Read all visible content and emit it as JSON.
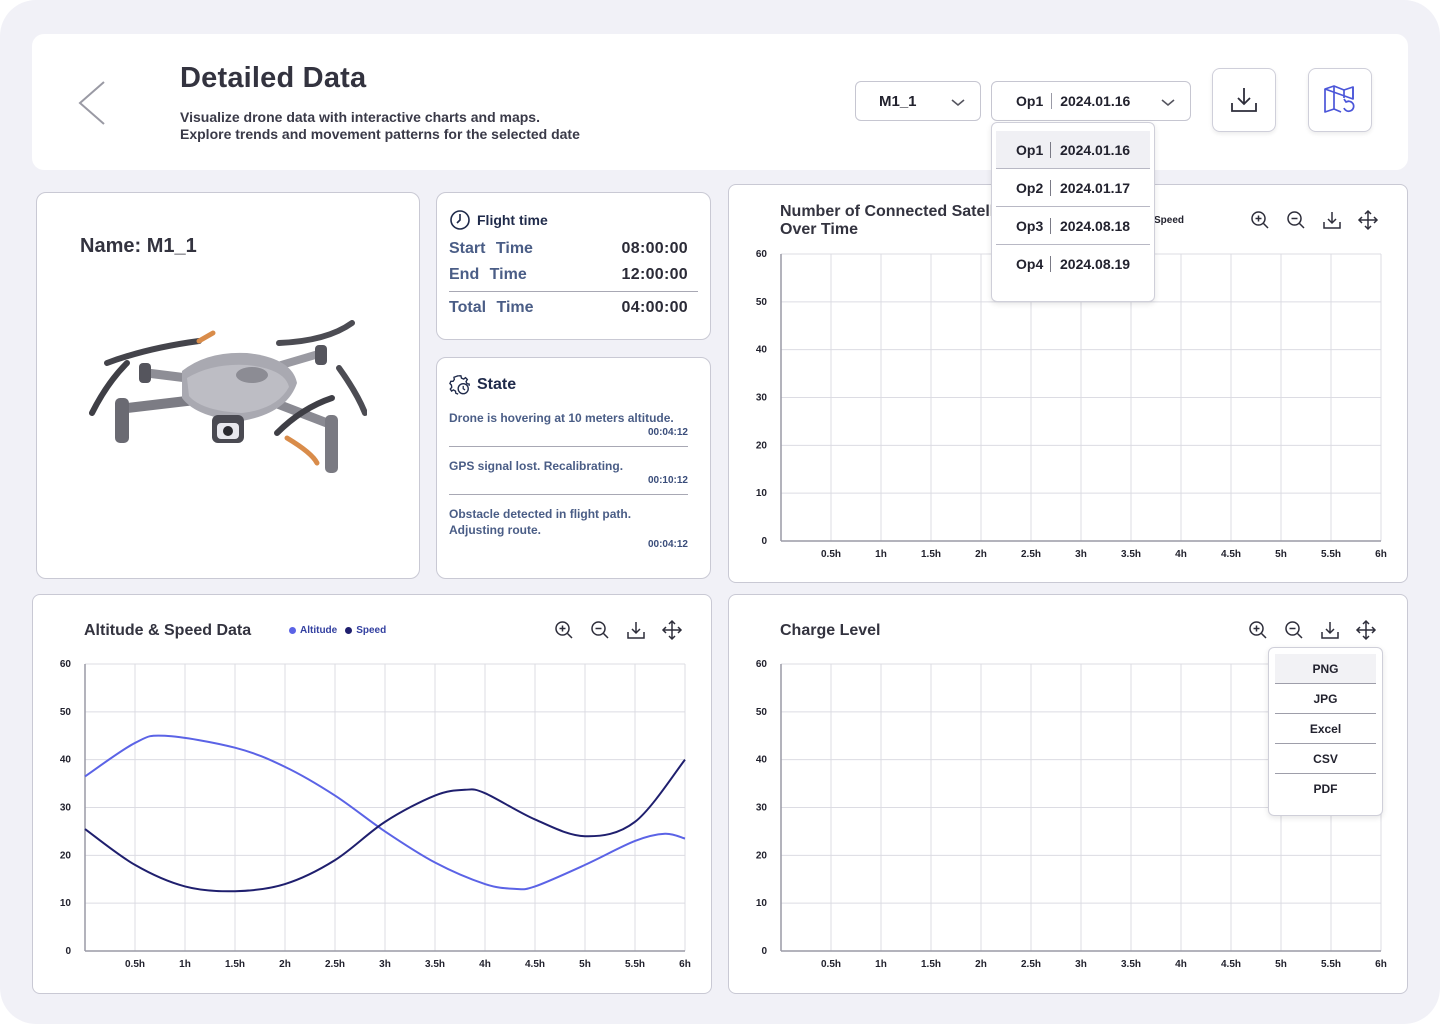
{
  "header": {
    "title": "Detailed Data",
    "subtitle_line1": "Visualize drone data with interactive charts and maps.",
    "subtitle_line2": "Explore trends and movement patterns for the selected date",
    "model_select": "M1_1",
    "op_select": {
      "op": "Op1",
      "date": "2024.01.16"
    },
    "op_options": [
      {
        "op": "Op1",
        "date": "2024.01.16",
        "selected": true
      },
      {
        "op": "Op2",
        "date": "2024.01.17",
        "selected": false
      },
      {
        "op": "Op3",
        "date": "2024.08.18",
        "selected": false
      },
      {
        "op": "Op4",
        "date": "2024.08.19",
        "selected": false
      }
    ]
  },
  "drone": {
    "name": "Name: M1_1"
  },
  "flight_time": {
    "title": "Flight time",
    "start_label": "Start Time",
    "start_value": "08:00:00",
    "end_label": "End Time",
    "end_value": "12:00:00",
    "total_label": "Total Time",
    "total_value": "04:00:00"
  },
  "state": {
    "title": "State",
    "items": [
      {
        "message": "Drone is hovering at 10 meters altitude.",
        "time": "00:04:12"
      },
      {
        "message": "GPS signal lost. Recalibrating.",
        "time": "00:10:12"
      },
      {
        "message": "Obstacle detected in flight path. Adjusting route.",
        "time": "00:04:12"
      }
    ]
  },
  "satellite_chart": {
    "title_line1": "Number of Connected Satell",
    "title_line2": "Over Time",
    "legend_partial": "Speed"
  },
  "altitude_chart": {
    "title": "Altitude & Speed Data",
    "legend": [
      "Altitude",
      "Speed"
    ]
  },
  "charge_chart": {
    "title": "Charge Level",
    "export_options": [
      "PNG",
      "JPG",
      "Excel",
      "CSV",
      "PDF"
    ]
  },
  "colors": {
    "altitude": "#5b63e6",
    "speed": "#1f1f6e",
    "grid": "#dcdce3"
  },
  "chart_data": [
    {
      "type": "line",
      "title": "Number of Connected Satell Over Time",
      "x": [
        "0.5h",
        "1h",
        "1.5h",
        "2h",
        "2.5h",
        "3h",
        "3.5h",
        "4h",
        "4.5h",
        "5h",
        "5.5h",
        "6h"
      ],
      "ylim": [
        0,
        60
      ],
      "yticks": [
        0,
        10,
        20,
        30,
        40,
        50,
        60
      ],
      "series": [],
      "grid": true
    },
    {
      "type": "line",
      "title": "Altitude & Speed Data",
      "x": [
        "0.5h",
        "1h",
        "1.5h",
        "2h",
        "2.5h",
        "3h",
        "3.5h",
        "4h",
        "4.5h",
        "5h",
        "5.5h",
        "6h"
      ],
      "ylim": [
        0,
        60
      ],
      "yticks": [
        0,
        10,
        20,
        30,
        40,
        50,
        60
      ],
      "grid": true,
      "legend_position": "top",
      "series": [
        {
          "name": "Altitude",
          "color": "#5b63e6",
          "points": [
            [
              0,
              36.5
            ],
            [
              0.5,
              43.5
            ],
            [
              0.8,
              45
            ],
            [
              1.5,
              42.5
            ],
            [
              2,
              38.5
            ],
            [
              2.5,
              32.5
            ],
            [
              3,
              25
            ],
            [
              3.5,
              18.5
            ],
            [
              4,
              14
            ],
            [
              4.3,
              13
            ],
            [
              4.5,
              13.5
            ],
            [
              5,
              18
            ],
            [
              5.5,
              23
            ],
            [
              5.8,
              24.5
            ],
            [
              6,
              23.5
            ]
          ]
        },
        {
          "name": "Speed",
          "color": "#1f1f6e",
          "points": [
            [
              0,
              25.5
            ],
            [
              0.5,
              18
            ],
            [
              1,
              13.5
            ],
            [
              1.5,
              12.5
            ],
            [
              2,
              14
            ],
            [
              2.5,
              19
            ],
            [
              3,
              27
            ],
            [
              3.5,
              32.5
            ],
            [
              3.8,
              33.7
            ],
            [
              4,
              33
            ],
            [
              4.5,
              27.5
            ],
            [
              5,
              24
            ],
            [
              5.5,
              27
            ],
            [
              6,
              40
            ]
          ]
        }
      ]
    },
    {
      "type": "line",
      "title": "Charge Level",
      "x": [
        "0.5h",
        "1h",
        "1.5h",
        "2h",
        "2.5h",
        "3h",
        "3.5h",
        "4h",
        "4.5h",
        "5h",
        "5.5h",
        "6h"
      ],
      "ylim": [
        0,
        60
      ],
      "yticks": [
        0,
        10,
        20,
        30,
        40,
        50,
        60
      ],
      "series": [],
      "grid": true
    }
  ]
}
